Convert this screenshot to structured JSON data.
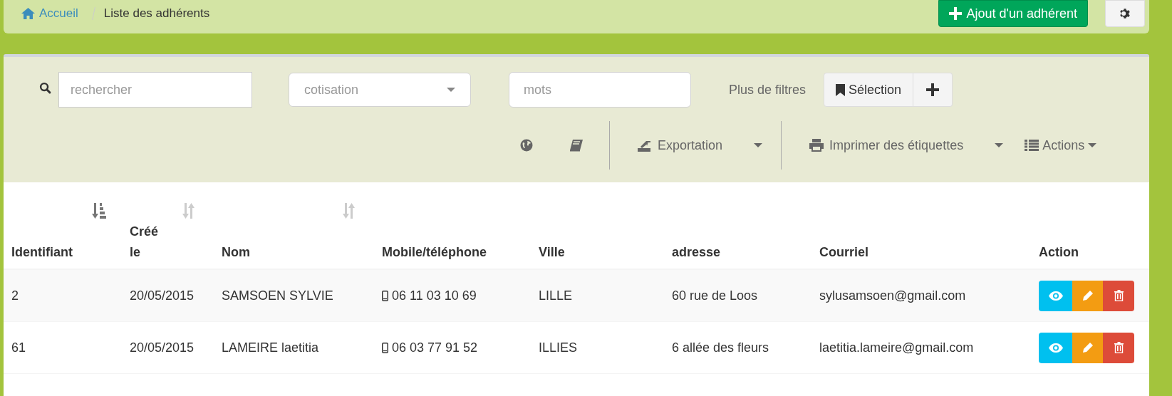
{
  "breadcrumb": [
    {
      "label": "Accueil",
      "kind": "home"
    },
    {
      "label": "Liste des adhérents",
      "kind": "current"
    }
  ],
  "add_button": "Ajout d'un adhérent",
  "filters": {
    "search_placeholder": "rechercher",
    "cotisation_placeholder": "cotisation",
    "words_placeholder": "mots",
    "more_filters": "Plus de filtres",
    "selection_button": "Sélection"
  },
  "toolbar": {
    "export": "Exportation",
    "print_labels": "Imprimer des étiquettes",
    "actions": "Actions"
  },
  "table": {
    "columns": [
      {
        "label": "Identifiant",
        "sorted": true
      },
      {
        "label": "Créé le",
        "sorted": false
      },
      {
        "label": "Nom",
        "sorted": false
      },
      {
        "label": "Mobile/téléphone"
      },
      {
        "label": "Ville"
      },
      {
        "label": "adresse"
      },
      {
        "label": "Courriel"
      },
      {
        "label": "Action"
      }
    ],
    "rows": [
      {
        "id": "2",
        "created": "20/05/2015",
        "name": "SAMSOEN SYLVIE",
        "phone": "06 11 03 10 69",
        "city": "LILLE",
        "address": "60 rue de Loos",
        "email": "sylusamsoen@gmail.com"
      },
      {
        "id": "61",
        "created": "20/05/2015",
        "name": "LAMEIRE laetitia",
        "phone": "06 03 77 91 52",
        "city": "ILLIES",
        "address": "6 allée des fleurs",
        "email": "laetitia.lameire@gmail.com"
      }
    ]
  }
}
